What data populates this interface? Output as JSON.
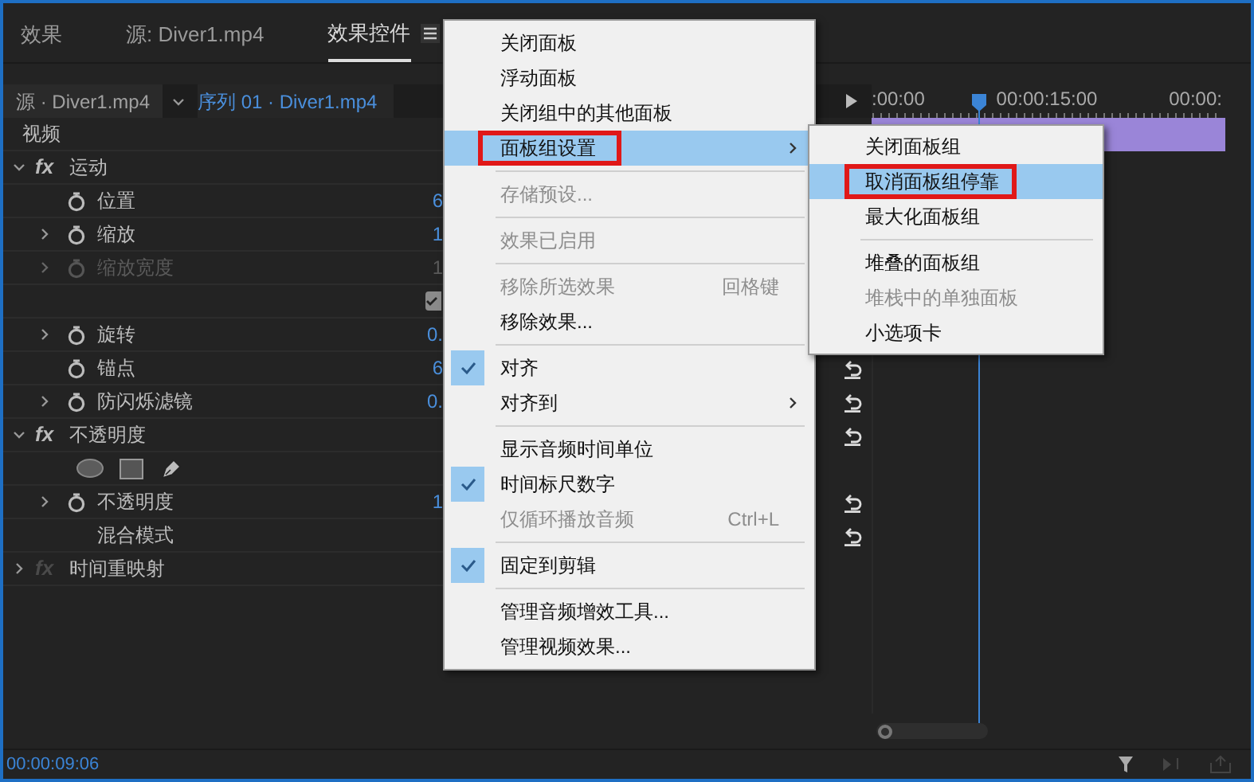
{
  "tabs": [
    {
      "label": "效果",
      "selected": false
    },
    {
      "label": "源: Diver1.mp4",
      "selected": false
    },
    {
      "label": "效果控件",
      "selected": true
    }
  ],
  "header": {
    "source": "源 · Diver1.mp4",
    "sequence": "序列 01 · Diver1.mp4"
  },
  "section": "视频",
  "effects": [
    {
      "name": "运动",
      "badge": "fx",
      "expanded": true,
      "enabled": true,
      "reset": false,
      "children": [
        {
          "kind": "property",
          "name": "位置",
          "expandable": false,
          "disabled": false,
          "value": "6",
          "reset": false
        },
        {
          "kind": "property",
          "name": "缩放",
          "expandable": true,
          "disabled": false,
          "value": "1",
          "reset": false
        },
        {
          "kind": "property",
          "name": "缩放宽度",
          "expandable": true,
          "disabled": true,
          "value": "1",
          "reset": false
        },
        {
          "kind": "checkbox",
          "checked": true,
          "reset": false
        },
        {
          "kind": "property",
          "name": "旋转",
          "expandable": true,
          "disabled": false,
          "value": "0.",
          "reset": false
        },
        {
          "kind": "property",
          "name": "锚点",
          "expandable": false,
          "disabled": false,
          "value": "6",
          "reset": true
        },
        {
          "kind": "property",
          "name": "防闪烁滤镜",
          "expandable": true,
          "disabled": false,
          "value": "0.",
          "reset": true
        }
      ]
    },
    {
      "name": "不透明度",
      "badge": "fx",
      "expanded": true,
      "enabled": true,
      "reset": true,
      "children": [
        {
          "kind": "mask-tools",
          "reset": false
        },
        {
          "kind": "property",
          "name": "不透明度",
          "expandable": true,
          "disabled": false,
          "value": "1",
          "reset": true
        },
        {
          "kind": "plain",
          "name": "混合模式",
          "reset": true
        }
      ]
    },
    {
      "name": "时间重映射",
      "badge": "fx",
      "expanded": false,
      "enabled": false,
      "reset": false
    }
  ],
  "timeline": {
    "ticks": [
      ":00:00",
      "00:00:15:00",
      "00:00:"
    ]
  },
  "timecode": "00:00:09:06",
  "menu": [
    {
      "kind": "item",
      "label": "关闭面板",
      "disabled": false,
      "checked": false,
      "selected": false,
      "submenu": false
    },
    {
      "kind": "item",
      "label": "浮动面板",
      "disabled": false,
      "checked": false,
      "selected": false,
      "submenu": false
    },
    {
      "kind": "item",
      "label": "关闭组中的其他面板",
      "disabled": false,
      "checked": false,
      "selected": false,
      "submenu": false
    },
    {
      "kind": "item",
      "label": "面板组设置",
      "disabled": false,
      "checked": false,
      "selected": true,
      "submenu": true,
      "highlighted": true
    },
    {
      "kind": "separator"
    },
    {
      "kind": "item",
      "label": "存储预设...",
      "disabled": true,
      "checked": false,
      "selected": false,
      "submenu": false
    },
    {
      "kind": "separator"
    },
    {
      "kind": "item",
      "label": "效果已启用",
      "disabled": true,
      "checked": false,
      "selected": false,
      "submenu": false
    },
    {
      "kind": "separator"
    },
    {
      "kind": "item",
      "label": "移除所选效果",
      "disabled": true,
      "checked": false,
      "selected": false,
      "submenu": false,
      "shortcut": "回格键"
    },
    {
      "kind": "item",
      "label": "移除效果...",
      "disabled": false,
      "checked": false,
      "selected": false,
      "submenu": false
    },
    {
      "kind": "separator"
    },
    {
      "kind": "item",
      "label": "对齐",
      "disabled": false,
      "checked": true,
      "selected": false,
      "submenu": false
    },
    {
      "kind": "item",
      "label": "对齐到",
      "disabled": false,
      "checked": false,
      "selected": false,
      "submenu": true
    },
    {
      "kind": "separator"
    },
    {
      "kind": "item",
      "label": "显示音频时间单位",
      "disabled": false,
      "checked": false,
      "selected": false,
      "submenu": false
    },
    {
      "kind": "item",
      "label": "时间标尺数字",
      "disabled": false,
      "checked": true,
      "selected": false,
      "submenu": false
    },
    {
      "kind": "item",
      "label": "仅循环播放音频",
      "disabled": true,
      "checked": false,
      "selected": false,
      "submenu": false,
      "shortcut": "Ctrl+L"
    },
    {
      "kind": "separator"
    },
    {
      "kind": "item",
      "label": "固定到剪辑",
      "disabled": false,
      "checked": true,
      "selected": false,
      "submenu": false
    },
    {
      "kind": "separator"
    },
    {
      "kind": "item",
      "label": "管理音频增效工具...",
      "disabled": false,
      "checked": false,
      "selected": false,
      "submenu": false
    },
    {
      "kind": "item",
      "label": "管理视频效果...",
      "disabled": false,
      "checked": false,
      "selected": false,
      "submenu": false
    }
  ],
  "submenu": [
    {
      "kind": "item",
      "label": "关闭面板组",
      "disabled": false,
      "selected": false
    },
    {
      "kind": "item",
      "label": "取消面板组停靠",
      "disabled": false,
      "selected": true,
      "highlighted": true
    },
    {
      "kind": "item",
      "label": "最大化面板组",
      "disabled": false,
      "selected": false
    },
    {
      "kind": "separator"
    },
    {
      "kind": "item",
      "label": "堆叠的面板组",
      "disabled": false,
      "selected": false
    },
    {
      "kind": "item",
      "label": "堆栈中的单独面板",
      "disabled": true,
      "selected": false
    },
    {
      "kind": "item",
      "label": "小选项卡",
      "disabled": false,
      "selected": false
    }
  ]
}
